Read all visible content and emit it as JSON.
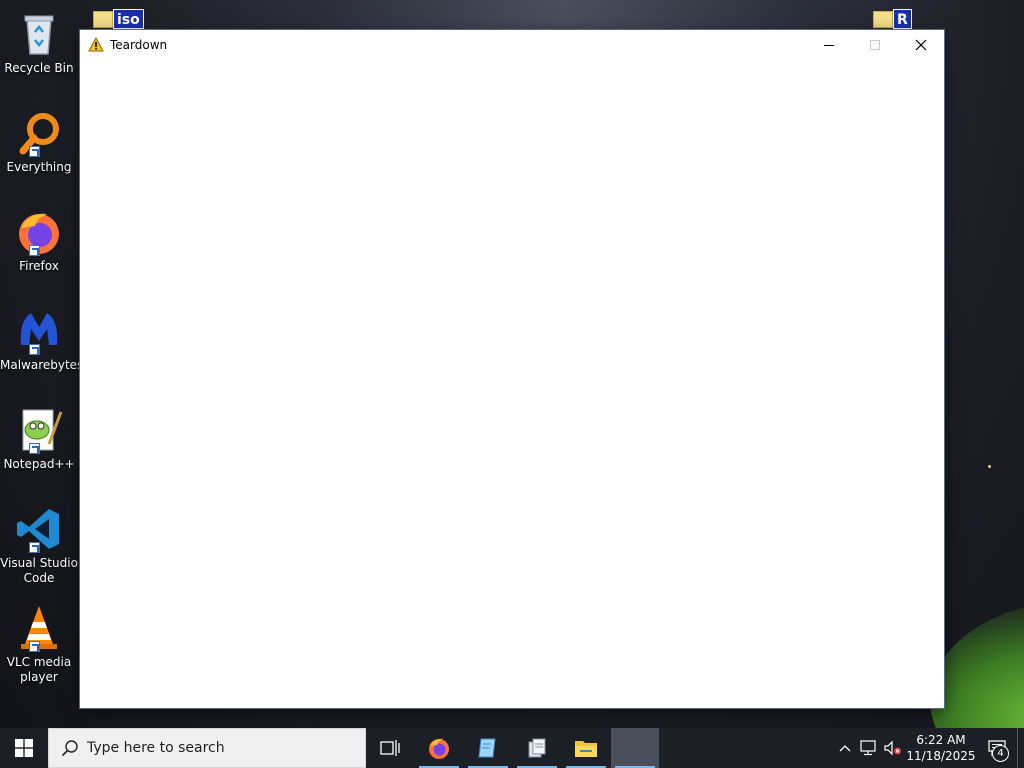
{
  "desktop": {
    "icons": [
      {
        "label": "Recycle Bin",
        "icon": "recycle-bin-icon"
      },
      {
        "label": "Everything",
        "icon": "everything-search-icon"
      },
      {
        "label": "Firefox",
        "icon": "firefox-icon"
      },
      {
        "label": "Malwarebytes",
        "icon": "malwarebytes-icon"
      },
      {
        "label": "Notepad++",
        "icon": "notepad-plus-plus-icon"
      },
      {
        "label": "Visual Studio Code",
        "icon": "vscode-icon"
      },
      {
        "label": "VLC media player",
        "icon": "vlc-icon"
      }
    ],
    "top_folders": [
      {
        "badge": "iso",
        "icon": "iso-folder-icon"
      },
      {
        "badge": "R",
        "icon": "r-folder-icon"
      }
    ]
  },
  "window": {
    "title": "Teardown",
    "icon": "warning-icon"
  },
  "taskbar": {
    "search_placeholder": "Type here to search",
    "pinned": [
      {
        "name": "task-view",
        "icon": "task-view-icon"
      },
      {
        "name": "firefox",
        "icon": "firefox-icon"
      },
      {
        "name": "app-blue",
        "icon": "notepad-app-icon"
      },
      {
        "name": "app-docs",
        "icon": "documents-app-icon"
      },
      {
        "name": "file-explorer",
        "icon": "folder-icon"
      },
      {
        "name": "teardown",
        "icon": "blank-window-icon"
      }
    ],
    "clock": {
      "time": "6:22 AM",
      "date": "11/18/2025"
    },
    "notification_count": "4"
  },
  "colors": {
    "taskbar_bg": "#1c1f26",
    "accent_indicator": "#76b9ed",
    "window_bg": "#ffffff"
  }
}
